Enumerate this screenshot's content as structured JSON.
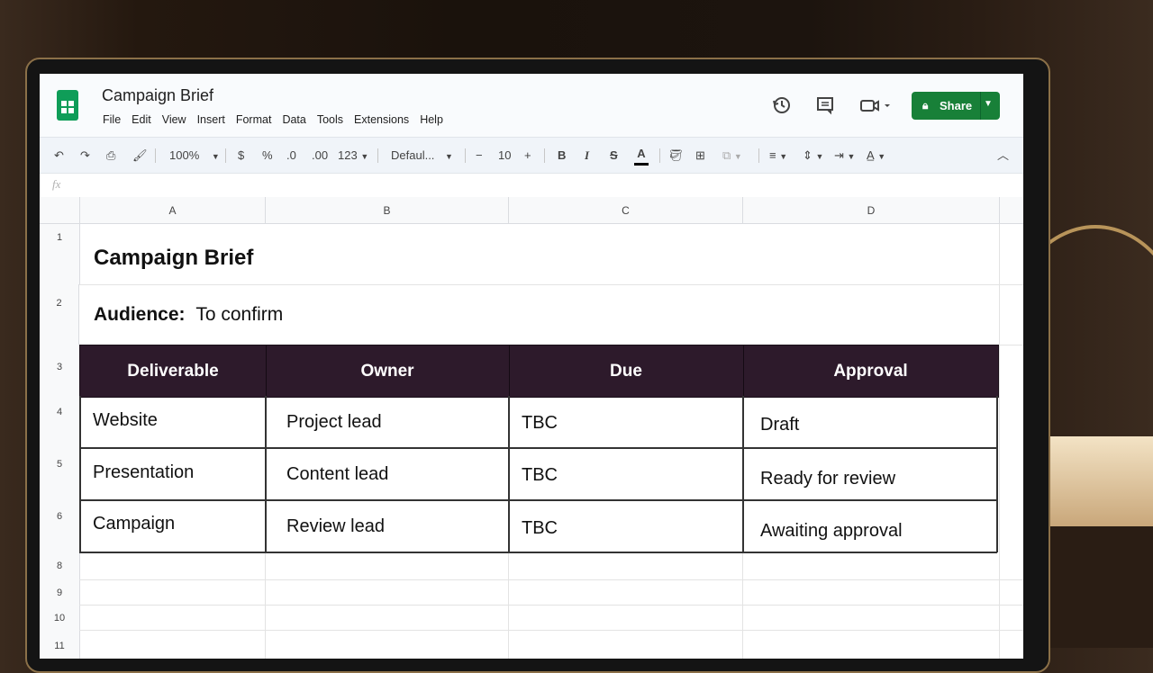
{
  "window": {
    "doc_title": "Campaign Brief",
    "menu": [
      "File",
      "Edit",
      "View",
      "Insert",
      "Format",
      "Data",
      "Tools",
      "Extensions",
      "Help"
    ],
    "share_label": "Share"
  },
  "toolbar": {
    "zoom": "100%",
    "currency": "$",
    "percent": "%",
    "decimal_dec": ".0",
    "decimal_inc": ".00",
    "number_format": "123",
    "font": "Defaul...",
    "minus": "−",
    "font_size": "10",
    "plus": "+",
    "bold": "B",
    "italic": "I",
    "strike": "S",
    "text_color": "A"
  },
  "formula_bar": {
    "fx": "fx"
  },
  "columns": [
    "A",
    "B",
    "C",
    "D"
  ],
  "rows": [
    "1",
    "2",
    "3",
    "4",
    "5",
    "6",
    "8",
    "9",
    "10",
    "11"
  ],
  "sheet": {
    "title": "Campaign Brief",
    "audience_label": "Audience:",
    "audience_value": "To confirm",
    "table": {
      "headers": [
        "Deliverable",
        "Owner",
        "Due",
        "Approval"
      ],
      "rows": [
        [
          "Website",
          "Project lead",
          "TBC",
          "Draft"
        ],
        [
          "Presentation",
          "Content lead",
          "TBC",
          "Ready for review"
        ],
        [
          "Campaign",
          "Review lead",
          "TBC",
          "Awaiting approval"
        ]
      ]
    }
  },
  "colors": {
    "header_fill": "#2d1a2b",
    "share_green": "#188038",
    "sheets_green": "#0f9d58"
  }
}
